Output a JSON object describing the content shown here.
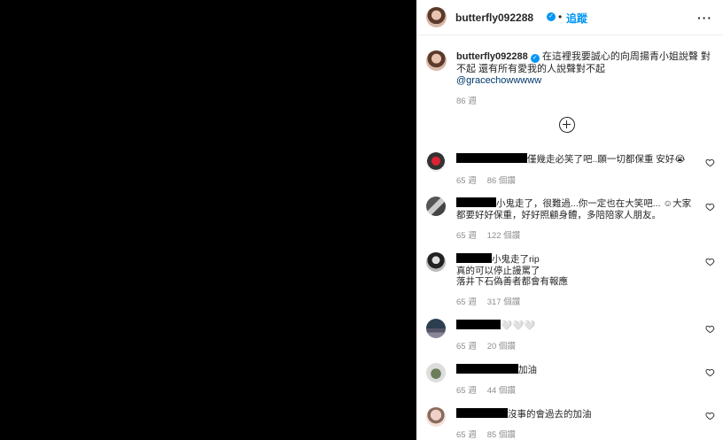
{
  "header": {
    "username": "butterfly092288",
    "verified_glyph": "✓",
    "dot": "•",
    "follow_label": "追蹤",
    "more_label": "···"
  },
  "caption": {
    "username": "butterfly092288",
    "text": "在這裡我要誠心的向周揚青小姐說聲 對不起 還有所有愛我的人說聲對不起",
    "mention": "@gracechowwwww",
    "time": "86 週"
  },
  "load_more_icon": "plus-circle-icon",
  "comments": [
    {
      "text_after": "僅幾走必笑了吧..願一切都保重 安好😭",
      "time": "65 週",
      "likes": "86 個讚",
      "avatar": "av-red"
    },
    {
      "text_after": "小鬼走了，很難過...你一定也在大笑吧... ☺大家都要好好保重，好好照顧身體，多陪陪家人朋友。",
      "time": "65 週",
      "likes": "122 個讚",
      "avatar": "av-gray"
    },
    {
      "text_after": "小鬼走了rip",
      "line2": "真的可以停止謾罵了",
      "line3": "落井下石偽善者都會有報應",
      "time": "65 週",
      "likes": "317 個讚",
      "avatar": "av-dark"
    },
    {
      "text_after": "🤍🤍🤍",
      "time": "65 週",
      "likes": "20 個讚",
      "avatar": "av-night"
    },
    {
      "text_after": "加油",
      "time": "65 週",
      "likes": "44 個讚",
      "avatar": "av-green"
    },
    {
      "text_after": "沒事的會過去的加油",
      "time": "65 週",
      "likes": "85 個讚",
      "avatar": "av-pink"
    }
  ],
  "colors": {
    "link": "#00376b",
    "follow": "#0095f6",
    "muted": "#8e8e8e"
  }
}
